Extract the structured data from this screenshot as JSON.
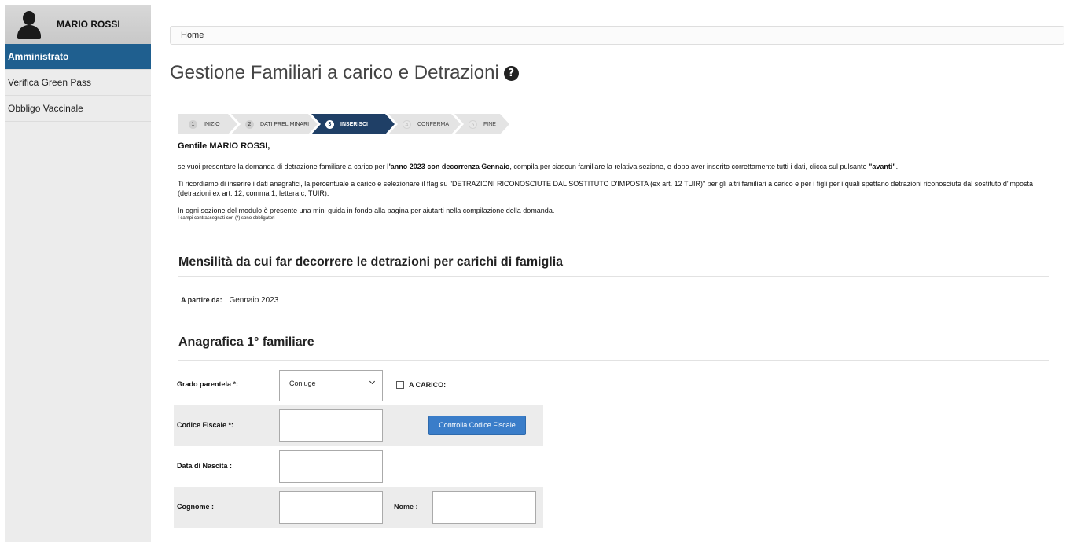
{
  "sidebar": {
    "user_name": "MARIO ROSSI",
    "items": [
      {
        "label": "Amministrato",
        "active": true
      },
      {
        "label": "Verifica Green Pass",
        "active": false
      },
      {
        "label": "Obbligo Vaccinale",
        "active": false
      }
    ]
  },
  "breadcrumb": {
    "home": "Home"
  },
  "page": {
    "title": "Gestione Familiari a carico e Detrazioni",
    "help_glyph": "?"
  },
  "steps": [
    {
      "num": "1",
      "label": "INIZIO",
      "state": "done"
    },
    {
      "num": "2",
      "label": "DATI PRELIMINARI",
      "state": "done"
    },
    {
      "num": "3",
      "label": "INSERISCI",
      "state": "active"
    },
    {
      "num": "4",
      "label": "CONFERMA",
      "state": "future"
    },
    {
      "num": "5",
      "label": "FINE",
      "state": "future"
    }
  ],
  "intro": {
    "greeting_prefix": "Gentile",
    "greeting_name": "MARIO ROSSI,",
    "p1_a": "se vuoi presentare la domanda di detrazione familiare a carico per ",
    "p1_b": "l'anno 2023 con decorrenza Gennaio",
    "p1_c": ", compila per ciascun familiare la relativa sezione, e dopo aver inserito correttamente tutti i dati, clicca sul pulsante ",
    "p1_d": "\"avanti\"",
    "p1_e": ".",
    "p2": "Ti ricordiamo di inserire i dati anagrafici, la percentuale a carico e selezionare il flag su \"DETRAZIONI RICONOSCIUTE DAL SOSTITUTO D'IMPOSTA (ex art. 12 TUIR)\" per gli altri familiari a carico e per i figli per i quali spettano detrazioni riconosciute dal sostituto d'imposta (detrazioni ex art. 12, comma 1, lettera c, TUIR).",
    "p3": "In ogni sezione del modulo è presente una mini guida in fondo alla pagina per aiutarti nella compilazione della domanda.",
    "note": "I campi contrassegnati con (*) sono obbligatori"
  },
  "section_month": {
    "title": "Mensilità da cui far decorrere le detrazioni per carichi di famiglia",
    "from_label": "A partire da:",
    "from_value": "Gennaio 2023"
  },
  "section_family": {
    "title": "Anagrafica 1° familiare",
    "grado_label": "Grado parentela *:",
    "grado_value": "Coniuge",
    "carico_label": "A CARICO:",
    "cf_label": "Codice Fiscale *:",
    "cf_button": "Controlla Codice Fiscale",
    "nascita_label": "Data di Nascita :",
    "cognome_label": "Cognome :",
    "nome_label": "Nome :"
  }
}
